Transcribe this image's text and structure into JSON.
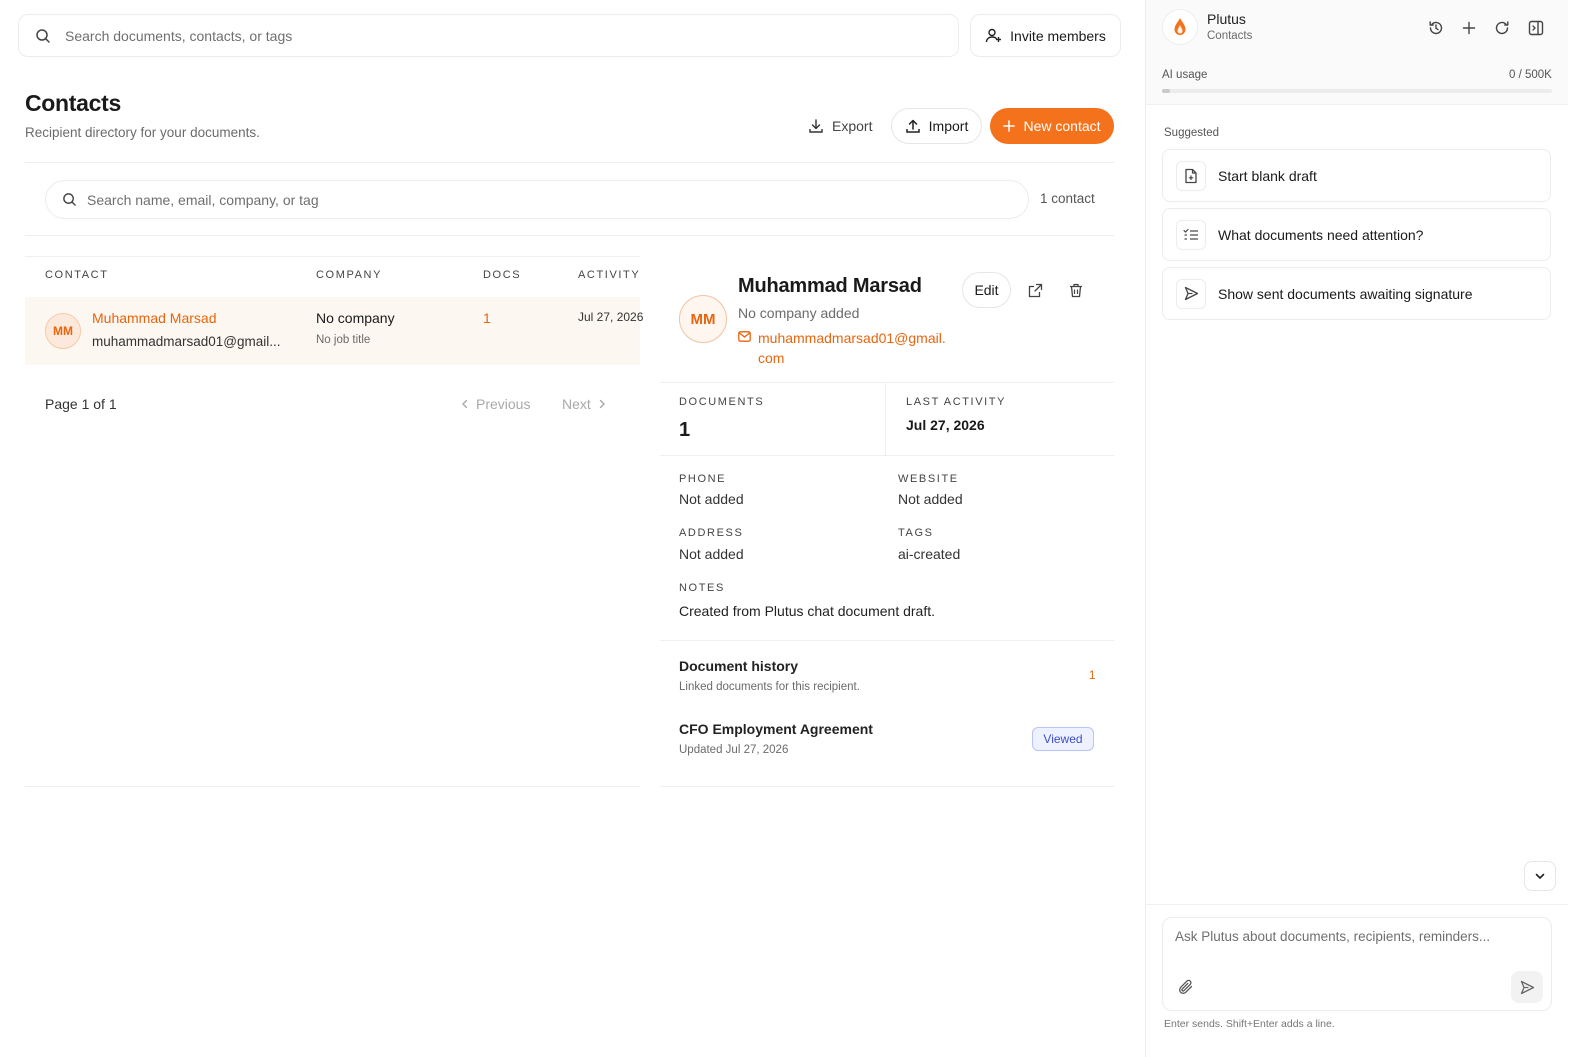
{
  "topbar": {
    "search_placeholder": "Search documents, contacts, or tags",
    "invite_label": "Invite members"
  },
  "header": {
    "title": "Contacts",
    "subtitle": "Recipient directory for your documents.",
    "export_label": "Export",
    "import_label": "Import",
    "new_contact_label": "New contact"
  },
  "filter": {
    "search_placeholder": "Search name, email, company, or tag",
    "count_label": "1 contact"
  },
  "table": {
    "columns": [
      "CONTACT",
      "COMPANY",
      "DOCS",
      "ACTIVITY"
    ],
    "rows": [
      {
        "initials": "MM",
        "name": "Muhammad Marsad",
        "email": "muhammadmarsad01@gmail...",
        "company": "No company",
        "job_title": "No job title",
        "docs": "1",
        "activity": "Jul 27, 2026"
      }
    ],
    "page_label": "Page 1 of 1",
    "prev_label": "Previous",
    "next_label": "Next"
  },
  "detail": {
    "initials": "MM",
    "name": "Muhammad Marsad",
    "company": "No company added",
    "email_line1": "muhammadmarsad01@gmail.",
    "email_line2": "com",
    "edit_label": "Edit",
    "documents_label": "DOCUMENTS",
    "documents_value": "1",
    "last_activity_label": "LAST ACTIVITY",
    "last_activity_value": "Jul 27, 2026",
    "phone_label": "PHONE",
    "phone_value": "Not added",
    "website_label": "WEBSITE",
    "website_value": "Not added",
    "address_label": "ADDRESS",
    "address_value": "Not added",
    "tags_label": "TAGS",
    "tags_value": "ai-created",
    "notes_label": "NOTES",
    "notes_value": "Created from Plutus chat document draft.",
    "history_title": "Document history",
    "history_sub": "Linked documents for this recipient.",
    "history_count": "1",
    "doc_title": "CFO Employment Agreement",
    "doc_updated": "Updated Jul 27, 2026",
    "doc_status": "Viewed"
  },
  "assistant": {
    "name": "Plutus",
    "context": "Contacts",
    "usage_label": "AI usage",
    "usage_value": "0 / 500K",
    "usage_fraction": 0.0,
    "suggested_label": "Suggested",
    "suggestions": [
      {
        "label": "Start blank draft",
        "icon": "file-plus-icon"
      },
      {
        "label": "What documents need attention?",
        "icon": "checklist-icon"
      },
      {
        "label": "Show sent documents awaiting signature",
        "icon": "send-icon"
      }
    ],
    "input_placeholder": "Ask Plutus about documents, recipients, reminders...",
    "hint": "Enter sends. Shift+Enter adds a line."
  },
  "colors": {
    "accent": "#f5721c",
    "accent_text": "#e8650f",
    "viewed_badge": "#3a4fc7"
  }
}
